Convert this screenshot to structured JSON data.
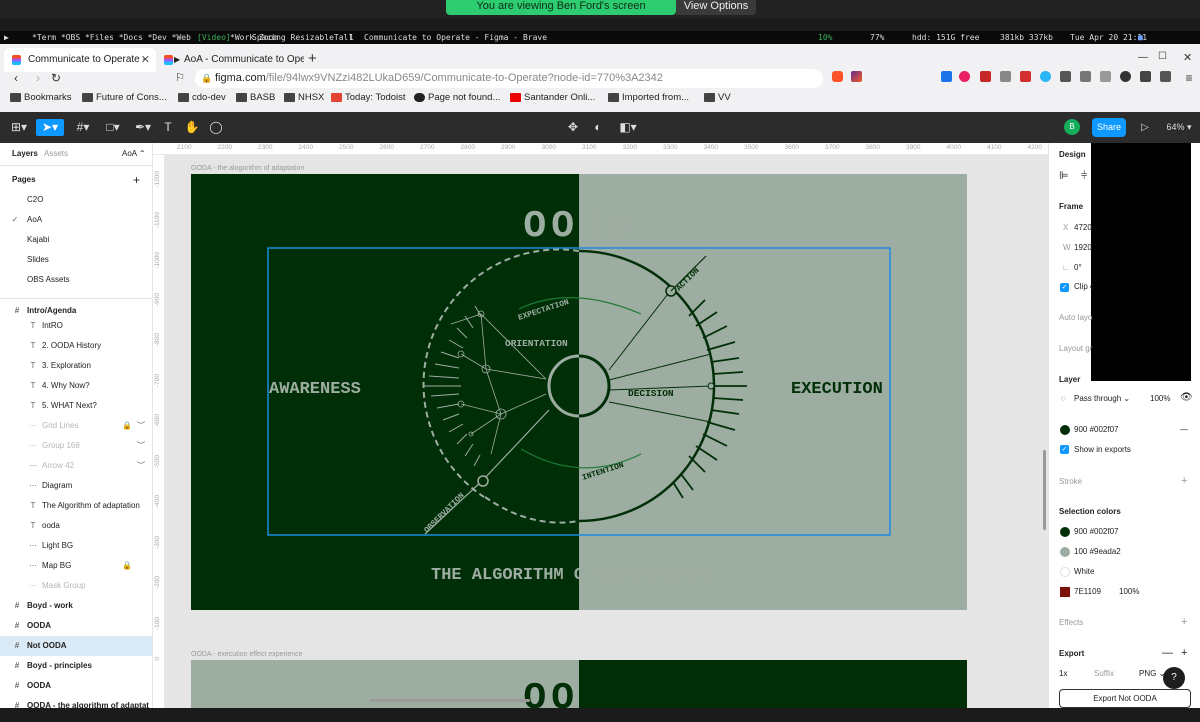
{
  "share_bar": {
    "message": "You are viewing Ben Ford's screen",
    "view_options": "View Options"
  },
  "status_bar": {
    "workspaces": "*Term *OBS *Files *Docs *Dev *Web",
    "video": "[Video]",
    "work_zoom": "*Work Zoom",
    "layout": "Spacing ResizableTall",
    "ws_num": "1",
    "window_title": "Communicate to Operate - Figma - Brave",
    "cpu": "10%",
    "mem": "77%",
    "disk": "hdd: 151G free",
    "net": "381kb 337kb",
    "clock": "Tue Apr 20 21:11"
  },
  "browser": {
    "tabs": [
      {
        "title": "Communicate to Operate -",
        "active": true
      },
      {
        "title": "AoA - Communicate to Oper",
        "active": false
      }
    ],
    "url_host": "figma.com",
    "url_path": "/file/94lwx9VNZzi482LUkaD659/Communicate-to-Operate?node-id=770%3A2342",
    "bookmarks": [
      "Bookmarks",
      "Future of Cons...",
      "cdo-dev",
      "BASB",
      "NHSX",
      "Today: Todoist",
      "Page not found...",
      "Santander Onli...",
      "Imported from...",
      "VV"
    ]
  },
  "figma": {
    "zoom": "64%",
    "share_label": "Share",
    "user_initial": "B",
    "left_panel": {
      "tabs": [
        "Layers",
        "Assets"
      ],
      "page_selector": "AoA",
      "pages_heading": "Pages",
      "pages": [
        "C2O",
        "AoA",
        "Kajabi",
        "Slides",
        "OBS Assets"
      ],
      "current_page": "AoA",
      "layers": [
        {
          "name": "Intro/Agenda",
          "type": "frame",
          "bold": true
        },
        {
          "name": "IntRO",
          "type": "text"
        },
        {
          "name": "2. OODA History",
          "type": "text"
        },
        {
          "name": "3. Exploration",
          "type": "text"
        },
        {
          "name": "4. Why Now?",
          "type": "text"
        },
        {
          "name": "5. WHAT Next?",
          "type": "text"
        },
        {
          "name": "Grid Lines",
          "type": "group",
          "muted": true
        },
        {
          "name": "Group 168",
          "type": "group",
          "muted": true
        },
        {
          "name": "Arrow 42",
          "type": "line",
          "muted": true
        },
        {
          "name": "Diagram",
          "type": "group"
        },
        {
          "name": "The Algorithm of adaptation",
          "type": "text"
        },
        {
          "name": "ooda",
          "type": "text"
        },
        {
          "name": "Light BG",
          "type": "group"
        },
        {
          "name": "Map BG",
          "type": "group"
        },
        {
          "name": "Mask Group",
          "type": "group",
          "muted": true
        },
        {
          "name": "Boyd - work",
          "type": "frame",
          "bold": true
        },
        {
          "name": "OODA",
          "type": "frame",
          "bold": true
        },
        {
          "name": "Not OODA",
          "type": "frame",
          "bold": true,
          "selected": true
        },
        {
          "name": "Boyd - principles",
          "type": "frame",
          "bold": true
        },
        {
          "name": "OODA",
          "type": "frame",
          "bold": true
        },
        {
          "name": "OODA - the algorithm of adaptat",
          "type": "frame",
          "bold": true
        }
      ]
    },
    "ruler_top": [
      "2100",
      "2200",
      "2300",
      "2400",
      "2500",
      "2600",
      "2700",
      "2800",
      "2900",
      "3000",
      "3100",
      "3200",
      "3300",
      "3400",
      "3500",
      "3600",
      "3700",
      "3800",
      "3900",
      "4000",
      "4100",
      "4200"
    ],
    "ruler_left": [
      "-1200",
      "-1100",
      "-1000",
      "-900",
      "-800",
      "-700",
      "-600",
      "-500",
      "-400",
      "-300",
      "-200",
      "-100",
      "0"
    ],
    "frame1_label": "OODA - the alogorithm of adaptation",
    "frame2_label": "OODA - execution effect experience",
    "diagram": {
      "title": "OODA",
      "left_label": "AWARENESS",
      "right_label": "EXECUTION",
      "orientation": "ORIENTATION",
      "decision": "DECISION",
      "expectation": "EXPECTATION",
      "action": "ACTION",
      "intention": "INTENTION",
      "observation": "OBSERVATION",
      "subtitle": "THE ALGORITHM OF ADAPTATION",
      "dark": "#002f07",
      "light": "#9eada2"
    },
    "right_panel": {
      "tabs": [
        "Design"
      ],
      "frame_heading": "Frame",
      "x": "4720",
      "w": "1920",
      "rotation": "0°",
      "clip": "Clip c",
      "auto_layout": "Auto layo",
      "layout_grid": "Layout gr",
      "layer_heading": "Layer",
      "blend": "Pass through",
      "opacity": "100%",
      "fill_label": "900 #002f07",
      "show_exports": "Show in exports",
      "stroke": "Stroke",
      "selection_colors_heading": "Selection colors",
      "selection_colors": [
        {
          "label": "900 #002f07",
          "color": "#002f07"
        },
        {
          "label": "100 #9eada2",
          "color": "#9eada2"
        },
        {
          "label": "White",
          "color": "#ffffff"
        },
        {
          "label": "7E1109",
          "color": "#7e1109",
          "opacity": "100%"
        }
      ],
      "effects": "Effects",
      "export_heading": "Export",
      "export_scale": "1x",
      "export_suffix": "Suffix",
      "export_format": "PNG",
      "export_button": "Export Not OODA"
    }
  }
}
